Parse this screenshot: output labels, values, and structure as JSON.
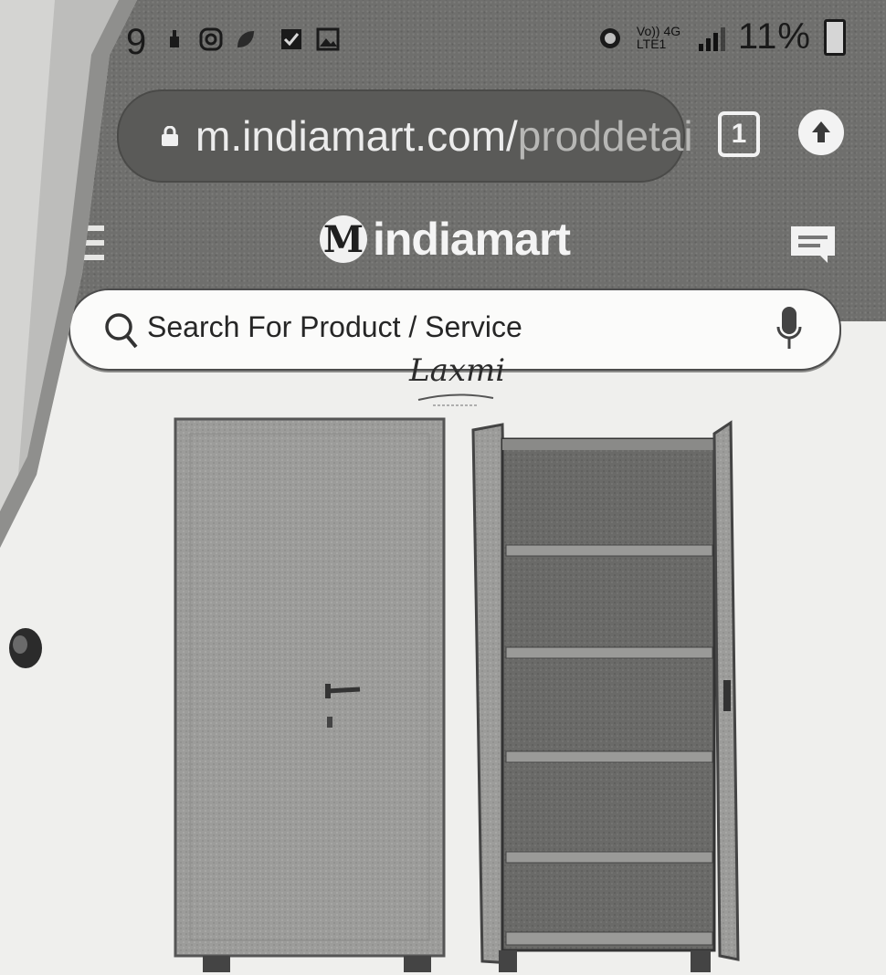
{
  "status_bar": {
    "time": "9",
    "network": "Vo)) 4G LTE1",
    "battery": "11%",
    "icons": [
      "usb-icon",
      "instagram-icon",
      "leaf-icon",
      "checkbox-icon",
      "gallery-icon",
      "alarm-icon",
      "signal-icon",
      "battery-icon"
    ]
  },
  "browser": {
    "url_host": "m.indiamart.com/",
    "url_path": "proddetai",
    "tab_count": "1",
    "icons": [
      "lock-icon",
      "update-icon"
    ]
  },
  "header": {
    "logo_badge": "M",
    "logo_text": "indiamart",
    "icons": [
      "hamburger-menu-icon",
      "message-icon"
    ]
  },
  "search": {
    "placeholder": "Search For Product / Service",
    "icons": [
      "search-icon",
      "microphone-icon"
    ]
  },
  "product": {
    "brand_logo": "Laxmi",
    "image_description_icons": [
      "closed-cabinet-icon",
      "open-cabinet-icon"
    ]
  },
  "colors": {
    "header_bg": "#6f6f6d",
    "page_bg": "#efefed",
    "search_bg": "#fbfbfa"
  }
}
